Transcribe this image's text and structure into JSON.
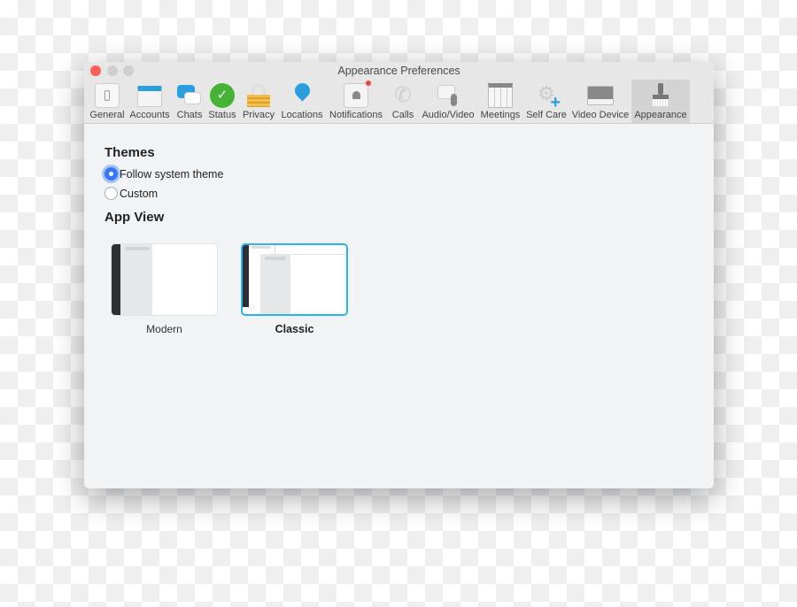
{
  "window": {
    "title": "Appearance Preferences"
  },
  "toolbar": {
    "items": [
      {
        "label": "General",
        "icon": "general-icon"
      },
      {
        "label": "Accounts",
        "icon": "accounts-icon"
      },
      {
        "label": "Chats",
        "icon": "chats-icon"
      },
      {
        "label": "Status",
        "icon": "status-icon"
      },
      {
        "label": "Privacy",
        "icon": "lock-icon"
      },
      {
        "label": "Locations",
        "icon": "location-pin-icon"
      },
      {
        "label": "Notifications",
        "icon": "bell-icon"
      },
      {
        "label": "Calls",
        "icon": "phone-icon"
      },
      {
        "label": "Audio/Video",
        "icon": "camera-mic-icon"
      },
      {
        "label": "Meetings",
        "icon": "calendar-icon"
      },
      {
        "label": "Self Care",
        "icon": "gear-plus-icon"
      },
      {
        "label": "Video Device",
        "icon": "monitor-icon"
      },
      {
        "label": "Appearance",
        "icon": "brush-icon",
        "selected": true
      }
    ]
  },
  "themes": {
    "heading": "Themes",
    "options": [
      {
        "label": "Follow system theme",
        "selected": true
      },
      {
        "label": "Custom",
        "selected": false
      }
    ]
  },
  "app_view": {
    "heading": "App View",
    "options": [
      {
        "label": "Modern",
        "selected": false
      },
      {
        "label": "Classic",
        "selected": true
      }
    ]
  },
  "colors": {
    "accent": "#3478f6",
    "selected_card": "#2bb5ea"
  }
}
